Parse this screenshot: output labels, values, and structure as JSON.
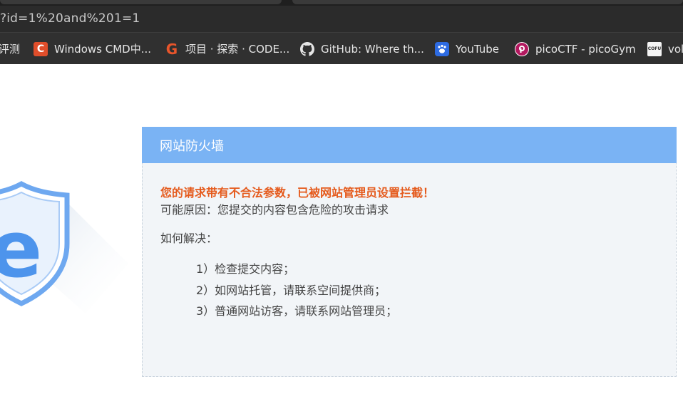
{
  "browser": {
    "address": "?id=1%20and%201=1",
    "bookmarks": [
      {
        "label": "评测",
        "icon": "none"
      },
      {
        "label": "Windows CMD中...",
        "icon": "c-logo-icon"
      },
      {
        "label": "项目 · 探索 · CODE...",
        "icon": "g-logo-icon"
      },
      {
        "label": "GitHub: Where th...",
        "icon": "github-icon"
      },
      {
        "label": "YouTube",
        "icon": "baidu-paw-icon"
      },
      {
        "label": "picoCTF - picoGym",
        "icon": "picoctf-icon"
      },
      {
        "label": "vol",
        "icon": "cofu-icon"
      }
    ],
    "cofu_text": "COFU"
  },
  "firewall": {
    "title": "网站防火墙",
    "warning": "您的请求带有不合法参数，已被网站管理员设置拦截！",
    "reason": "可能原因：您提交的内容包含危险的攻击请求",
    "how_label": "如何解决：",
    "steps": [
      "1）检查提交内容；",
      "2）如网站托管，请联系空间提供商；",
      "3）普通网站访客，请联系网站管理员；"
    ],
    "logo_letter": "e"
  },
  "colors": {
    "header_blue": "#7ab3f4",
    "warning_orange": "#e55a1c",
    "panel_bg": "#f2f5f8",
    "shield_blue": "#4d94ec"
  }
}
